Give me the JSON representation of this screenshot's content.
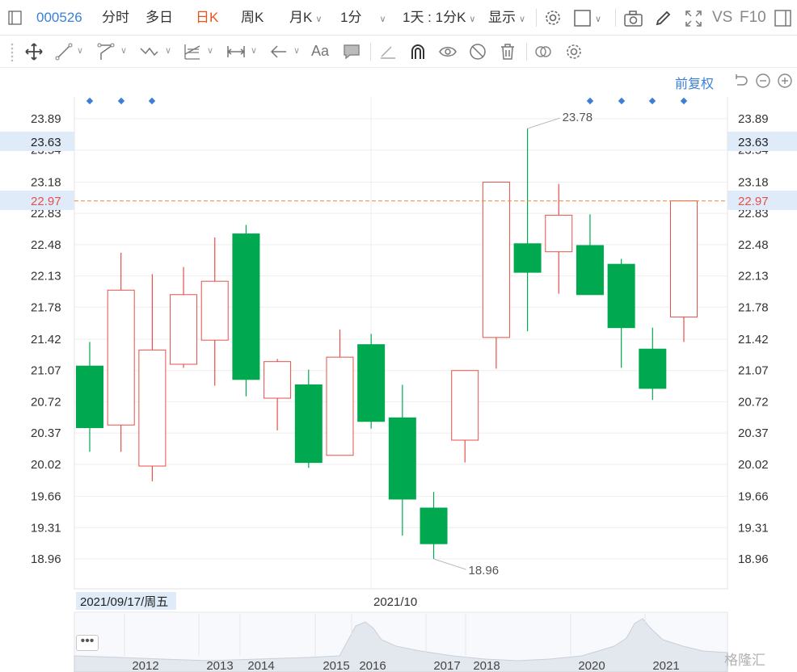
{
  "toolbar": {
    "stock_code": "000526",
    "tabs": [
      "分时",
      "多日",
      "日K",
      "周K"
    ],
    "active_tab": "日K",
    "month_label": "月K",
    "minute_label": "1分",
    "period_label": "1天 : 1分K",
    "display_label": "显示",
    "vs_label": "VS",
    "f10_label": "F10"
  },
  "toolbar2": {
    "icons": [
      "move-icon",
      "line-icon",
      "polyline-icon",
      "wave-icon",
      "fib-icon",
      "measure-icon",
      "arrow-left-icon",
      "text-icon",
      "comment-icon",
      "eraser-icon",
      "magnet-icon",
      "eye-icon",
      "hide-icon",
      "trash-icon",
      "link-icon",
      "settings-icon"
    ],
    "text_tool_label": "Aa"
  },
  "adjust_label": "前复权",
  "crosshair": {
    "date_label": "2021/09/17/周五",
    "price_label": "22.97",
    "secondary_price_label": "23.63"
  },
  "x_axis_mid_label": "2021/10",
  "watermark": "格隆汇",
  "colors": {
    "up": "#e5504a",
    "down": "#00a94f",
    "accent": "#3b7fd9",
    "active": "#e4571c",
    "guide": "#e6893f"
  },
  "chart_data": {
    "type": "candlestick",
    "y_ticks": [
      "23.89",
      "23.54",
      "23.18",
      "22.83",
      "22.48",
      "22.13",
      "21.78",
      "21.42",
      "21.07",
      "20.72",
      "20.37",
      "20.02",
      "19.66",
      "19.31",
      "18.96"
    ],
    "ylim": [
      18.96,
      23.89
    ],
    "high_label": "23.78",
    "low_label": "18.96",
    "reference_line": 22.97,
    "candles": [
      {
        "open": 21.12,
        "close": 20.43,
        "high": 21.39,
        "low": 20.16
      },
      {
        "open": 20.46,
        "close": 21.97,
        "high": 22.39,
        "low": 20.16
      },
      {
        "open": 20.0,
        "close": 21.3,
        "high": 22.15,
        "low": 19.83
      },
      {
        "open": 21.14,
        "close": 21.92,
        "high": 22.23,
        "low": 21.1
      },
      {
        "open": 21.41,
        "close": 22.07,
        "high": 22.56,
        "low": 20.9
      },
      {
        "open": 22.6,
        "close": 20.97,
        "high": 22.7,
        "low": 20.78
      },
      {
        "open": 20.76,
        "close": 21.17,
        "high": 21.2,
        "low": 20.4
      },
      {
        "open": 20.91,
        "close": 20.04,
        "high": 21.08,
        "low": 19.98
      },
      {
        "open": 20.12,
        "close": 21.22,
        "high": 21.53,
        "low": 20.12
      },
      {
        "open": 21.36,
        "close": 20.5,
        "high": 21.48,
        "low": 20.42
      },
      {
        "open": 20.54,
        "close": 19.63,
        "high": 20.91,
        "low": 19.22
      },
      {
        "open": 19.53,
        "close": 19.13,
        "high": 19.71,
        "low": 18.96
      },
      {
        "open": 20.29,
        "close": 21.07,
        "high": 21.07,
        "low": 20.04
      },
      {
        "open": 21.44,
        "close": 23.18,
        "high": 23.18,
        "low": 21.09
      },
      {
        "open": 22.49,
        "close": 22.17,
        "high": 23.78,
        "low": 21.51
      },
      {
        "open": 22.4,
        "close": 22.81,
        "high": 23.16,
        "low": 21.93
      },
      {
        "open": 22.47,
        "close": 21.92,
        "high": 22.82,
        "low": 21.92
      },
      {
        "open": 22.26,
        "close": 21.55,
        "high": 22.32,
        "low": 21.1
      },
      {
        "open": 21.31,
        "close": 20.87,
        "high": 21.55,
        "low": 20.74
      },
      {
        "open": 21.67,
        "close": 22.97,
        "high": 22.97,
        "low": 21.39
      }
    ],
    "overview_years": [
      "2012",
      "2013",
      "2014",
      "2015",
      "2016",
      "2017",
      "2018",
      "2020",
      "2021"
    ]
  }
}
